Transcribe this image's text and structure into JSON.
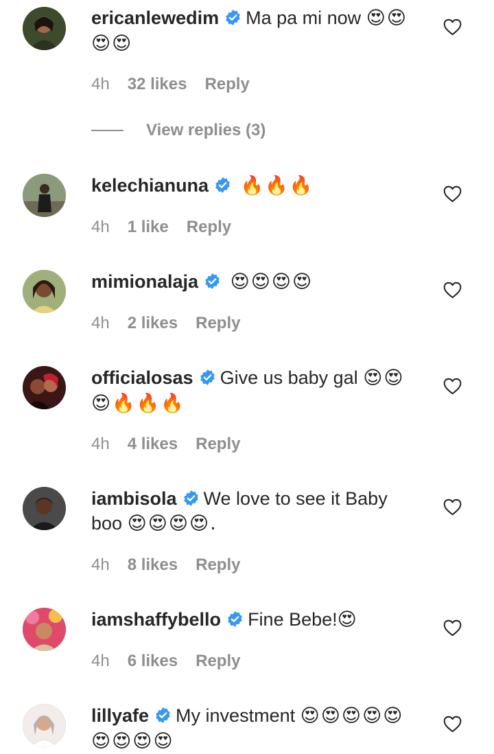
{
  "comments": [
    {
      "username": "ericanlewedim",
      "text": "Ma pa mi now",
      "emoji": "😍😍😍😍",
      "time": "4h",
      "likes": "32 likes",
      "reply": "Reply"
    },
    {
      "username": "kelechianuna",
      "text": "",
      "emoji": "🔥🔥🔥",
      "time": "4h",
      "likes": "1 like",
      "reply": "Reply"
    },
    {
      "username": "mimionalaja",
      "text": "",
      "emoji": "😍😍😍😍",
      "time": "4h",
      "likes": "2 likes",
      "reply": "Reply"
    },
    {
      "username": "officialosas",
      "text": "Give us baby gal",
      "emoji": "😍😍😍🔥🔥🔥",
      "time": "4h",
      "likes": "4 likes",
      "reply": "Reply"
    },
    {
      "username": "iambisola",
      "text": "We love to see it Baby boo",
      "emoji": "😍😍😍😍.",
      "time": "4h",
      "likes": "8 likes",
      "reply": "Reply"
    },
    {
      "username": "iamshaffybello",
      "text": "Fine Bebe!",
      "emoji": "😍",
      "time": "4h",
      "likes": "6 likes",
      "reply": "Reply"
    },
    {
      "username": "lillyafe",
      "text": "My investment",
      "emoji": "😍😍😍😍😍😍😍😍😍",
      "time": "",
      "likes": "",
      "reply": ""
    }
  ],
  "view_replies": "View replies (3)",
  "icons": {
    "verified": "verified-badge-icon",
    "like": "heart-outline-icon"
  },
  "colors": {
    "verified_blue": "#3897f0",
    "meta_gray": "#8e8e8e",
    "text": "#262626"
  }
}
